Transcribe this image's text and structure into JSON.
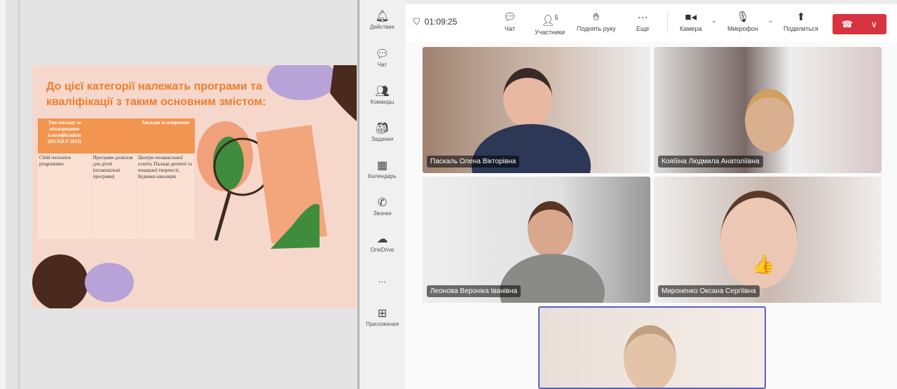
{
  "slide": {
    "title": "До цієї категорії належать програми та кваліфікації з таким основним змістом:",
    "table": {
      "headers": [
        "Тип закладу за міжнародною класифікацією (ISCED-F 2013)",
        "",
        "Заклади за напрямом"
      ],
      "row": [
        "Child recreation programmes",
        "Програми дозвілля для дітей (позашкільні програми)",
        "Центри позашкільної освіти, Палаци дитячої та юнацької творчості, Будинки школярів"
      ]
    }
  },
  "rail": [
    {
      "icon": "bell-icon",
      "label": "Действие"
    },
    {
      "icon": "chat-icon",
      "label": "Чат"
    },
    {
      "icon": "teams-icon",
      "label": "Команды"
    },
    {
      "icon": "assignments-icon",
      "label": "Задания"
    },
    {
      "icon": "calendar-icon",
      "label": "Календарь"
    },
    {
      "icon": "phone-icon",
      "label": "Звонки"
    },
    {
      "icon": "cloud-icon",
      "label": "OneDrive"
    },
    {
      "icon": "more-icon",
      "label": "..."
    },
    {
      "icon": "apps-icon",
      "label": "Приложения"
    }
  ],
  "toolbar": {
    "timer": "01:09:25",
    "chat": "Чат",
    "participants": "Участники",
    "participants_count": "5",
    "raise_hand": "Поднять руку",
    "more": "Еще",
    "camera": "Камера",
    "mic": "Микрофон",
    "share": "Поделиться"
  },
  "participants": [
    "Паскаль Олена Вікторівна",
    "Коябіна Людмила Анатоліївна",
    "Леонова Вероніка Іванівна",
    "Мироненко Оксана Сергіївна"
  ]
}
